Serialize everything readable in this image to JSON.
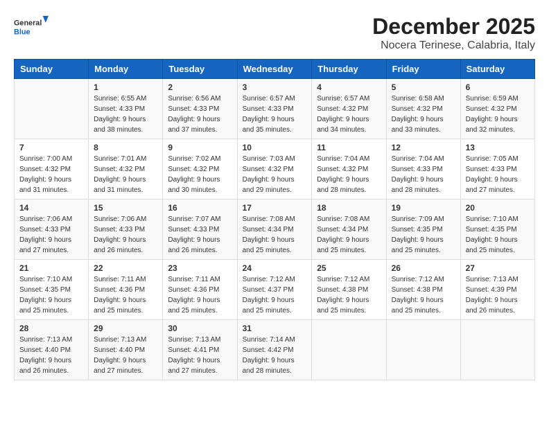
{
  "logo": {
    "general": "General",
    "blue": "Blue"
  },
  "title": "December 2025",
  "subtitle": "Nocera Terinese, Calabria, Italy",
  "headers": [
    "Sunday",
    "Monday",
    "Tuesday",
    "Wednesday",
    "Thursday",
    "Friday",
    "Saturday"
  ],
  "weeks": [
    [
      {
        "day": "",
        "info": ""
      },
      {
        "day": "1",
        "info": "Sunrise: 6:55 AM\nSunset: 4:33 PM\nDaylight: 9 hours\nand 38 minutes."
      },
      {
        "day": "2",
        "info": "Sunrise: 6:56 AM\nSunset: 4:33 PM\nDaylight: 9 hours\nand 37 minutes."
      },
      {
        "day": "3",
        "info": "Sunrise: 6:57 AM\nSunset: 4:33 PM\nDaylight: 9 hours\nand 35 minutes."
      },
      {
        "day": "4",
        "info": "Sunrise: 6:57 AM\nSunset: 4:32 PM\nDaylight: 9 hours\nand 34 minutes."
      },
      {
        "day": "5",
        "info": "Sunrise: 6:58 AM\nSunset: 4:32 PM\nDaylight: 9 hours\nand 33 minutes."
      },
      {
        "day": "6",
        "info": "Sunrise: 6:59 AM\nSunset: 4:32 PM\nDaylight: 9 hours\nand 32 minutes."
      }
    ],
    [
      {
        "day": "7",
        "info": "Sunrise: 7:00 AM\nSunset: 4:32 PM\nDaylight: 9 hours\nand 31 minutes."
      },
      {
        "day": "8",
        "info": "Sunrise: 7:01 AM\nSunset: 4:32 PM\nDaylight: 9 hours\nand 31 minutes."
      },
      {
        "day": "9",
        "info": "Sunrise: 7:02 AM\nSunset: 4:32 PM\nDaylight: 9 hours\nand 30 minutes."
      },
      {
        "day": "10",
        "info": "Sunrise: 7:03 AM\nSunset: 4:32 PM\nDaylight: 9 hours\nand 29 minutes."
      },
      {
        "day": "11",
        "info": "Sunrise: 7:04 AM\nSunset: 4:32 PM\nDaylight: 9 hours\nand 28 minutes."
      },
      {
        "day": "12",
        "info": "Sunrise: 7:04 AM\nSunset: 4:33 PM\nDaylight: 9 hours\nand 28 minutes."
      },
      {
        "day": "13",
        "info": "Sunrise: 7:05 AM\nSunset: 4:33 PM\nDaylight: 9 hours\nand 27 minutes."
      }
    ],
    [
      {
        "day": "14",
        "info": "Sunrise: 7:06 AM\nSunset: 4:33 PM\nDaylight: 9 hours\nand 27 minutes."
      },
      {
        "day": "15",
        "info": "Sunrise: 7:06 AM\nSunset: 4:33 PM\nDaylight: 9 hours\nand 26 minutes."
      },
      {
        "day": "16",
        "info": "Sunrise: 7:07 AM\nSunset: 4:33 PM\nDaylight: 9 hours\nand 26 minutes."
      },
      {
        "day": "17",
        "info": "Sunrise: 7:08 AM\nSunset: 4:34 PM\nDaylight: 9 hours\nand 25 minutes."
      },
      {
        "day": "18",
        "info": "Sunrise: 7:08 AM\nSunset: 4:34 PM\nDaylight: 9 hours\nand 25 minutes."
      },
      {
        "day": "19",
        "info": "Sunrise: 7:09 AM\nSunset: 4:35 PM\nDaylight: 9 hours\nand 25 minutes."
      },
      {
        "day": "20",
        "info": "Sunrise: 7:10 AM\nSunset: 4:35 PM\nDaylight: 9 hours\nand 25 minutes."
      }
    ],
    [
      {
        "day": "21",
        "info": "Sunrise: 7:10 AM\nSunset: 4:35 PM\nDaylight: 9 hours\nand 25 minutes."
      },
      {
        "day": "22",
        "info": "Sunrise: 7:11 AM\nSunset: 4:36 PM\nDaylight: 9 hours\nand 25 minutes."
      },
      {
        "day": "23",
        "info": "Sunrise: 7:11 AM\nSunset: 4:36 PM\nDaylight: 9 hours\nand 25 minutes."
      },
      {
        "day": "24",
        "info": "Sunrise: 7:12 AM\nSunset: 4:37 PM\nDaylight: 9 hours\nand 25 minutes."
      },
      {
        "day": "25",
        "info": "Sunrise: 7:12 AM\nSunset: 4:38 PM\nDaylight: 9 hours\nand 25 minutes."
      },
      {
        "day": "26",
        "info": "Sunrise: 7:12 AM\nSunset: 4:38 PM\nDaylight: 9 hours\nand 25 minutes."
      },
      {
        "day": "27",
        "info": "Sunrise: 7:13 AM\nSunset: 4:39 PM\nDaylight: 9 hours\nand 26 minutes."
      }
    ],
    [
      {
        "day": "28",
        "info": "Sunrise: 7:13 AM\nSunset: 4:40 PM\nDaylight: 9 hours\nand 26 minutes."
      },
      {
        "day": "29",
        "info": "Sunrise: 7:13 AM\nSunset: 4:40 PM\nDaylight: 9 hours\nand 27 minutes."
      },
      {
        "day": "30",
        "info": "Sunrise: 7:13 AM\nSunset: 4:41 PM\nDaylight: 9 hours\nand 27 minutes."
      },
      {
        "day": "31",
        "info": "Sunrise: 7:14 AM\nSunset: 4:42 PM\nDaylight: 9 hours\nand 28 minutes."
      },
      {
        "day": "",
        "info": ""
      },
      {
        "day": "",
        "info": ""
      },
      {
        "day": "",
        "info": ""
      }
    ]
  ]
}
